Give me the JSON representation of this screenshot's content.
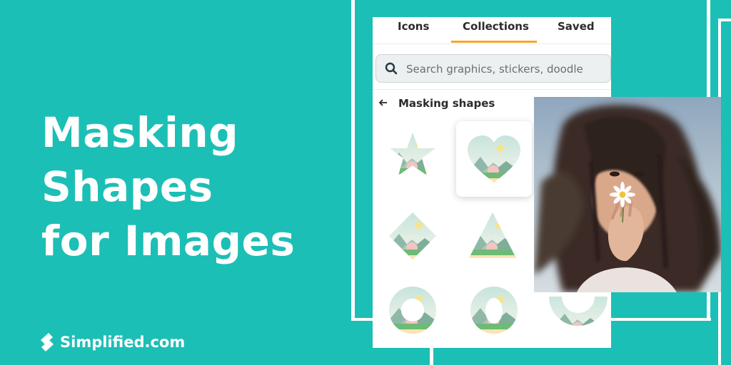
{
  "headline": {
    "line1": "Masking",
    "line2": "Shapes",
    "line3": "for Images"
  },
  "brand": {
    "name": "Simplified.com"
  },
  "tabs": [
    {
      "label": "Icons"
    },
    {
      "label": "Collections",
      "active": true
    },
    {
      "label": "Saved"
    }
  ],
  "search": {
    "placeholder": "Search graphics, stickers, doodle",
    "value": ""
  },
  "section": {
    "title": "Masking shapes"
  },
  "shapes": [
    {
      "name": "star"
    },
    {
      "name": "heart",
      "selected": true
    },
    {
      "name": "diamond"
    },
    {
      "name": "triangle"
    },
    {
      "name": "ring"
    },
    {
      "name": "oval-ring"
    },
    {
      "name": "arc"
    }
  ],
  "colors": {
    "background": "#1cbfb5",
    "accent": "#f3a826",
    "text": "#2b2b2b"
  }
}
